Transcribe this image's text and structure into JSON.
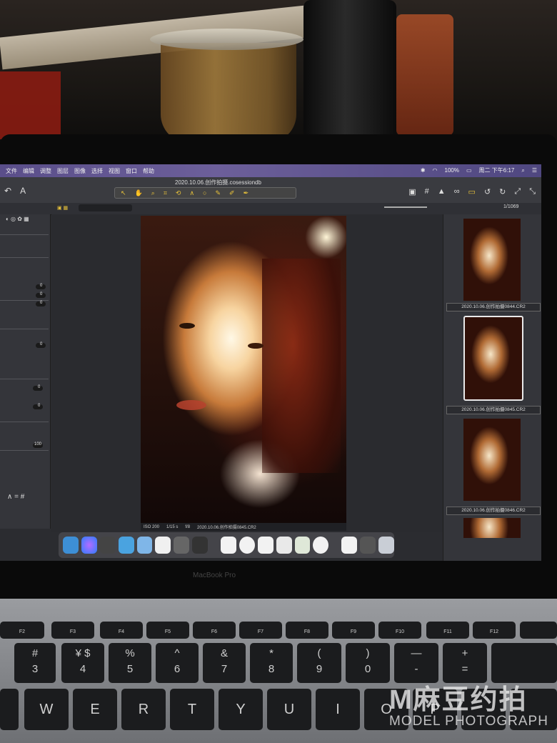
{
  "menubar": {
    "items": [
      "文件",
      "编辑",
      "调整",
      "图层",
      "图像",
      "选择",
      "视图",
      "窗口",
      "帮助"
    ],
    "battery": "100%",
    "clock": "周二 下午6:17"
  },
  "window": {
    "title": "2020.10.06.创作拍摄.cosessiondb"
  },
  "viewer_status": {
    "iso": "ISO 200",
    "shutter": "1/15 s",
    "aperture": "f/8",
    "filename": "2020.10.06.创作拍摄0845.CR2"
  },
  "browser": {
    "counter": "1/1069",
    "thumbnails": [
      {
        "caption": "2020.10.06.创作拍摄0844.CR2",
        "selected": false
      },
      {
        "caption": "2020.10.06.创作拍摄0845.CR2",
        "selected": true
      },
      {
        "caption": "2020.10.06.创作拍摄0846.CR2",
        "selected": false
      }
    ]
  },
  "left_panel": {
    "values": [
      "0",
      "0",
      "0",
      "0",
      "0",
      "0",
      "100"
    ]
  },
  "laptop_label": "MacBook Pro",
  "keyboard": {
    "fkeys": [
      "F2",
      "F3",
      "F4",
      "F5",
      "F6",
      "F7",
      "F8",
      "F9",
      "F10",
      "F11",
      "F12"
    ],
    "numrow": [
      "#\n3",
      "¥ $\n4",
      "%\n5",
      "^\n6",
      "&\n7",
      "*\n8",
      "(\n9",
      ")\n0",
      "—\n-",
      "+\n="
    ],
    "alpha": [
      "W",
      "E",
      "R",
      "T",
      "Y",
      "U",
      "I",
      "O",
      "P"
    ]
  },
  "watermark": {
    "title": "M麻豆约拍",
    "subtitle": "MODEL PHOTOGRAPH"
  }
}
